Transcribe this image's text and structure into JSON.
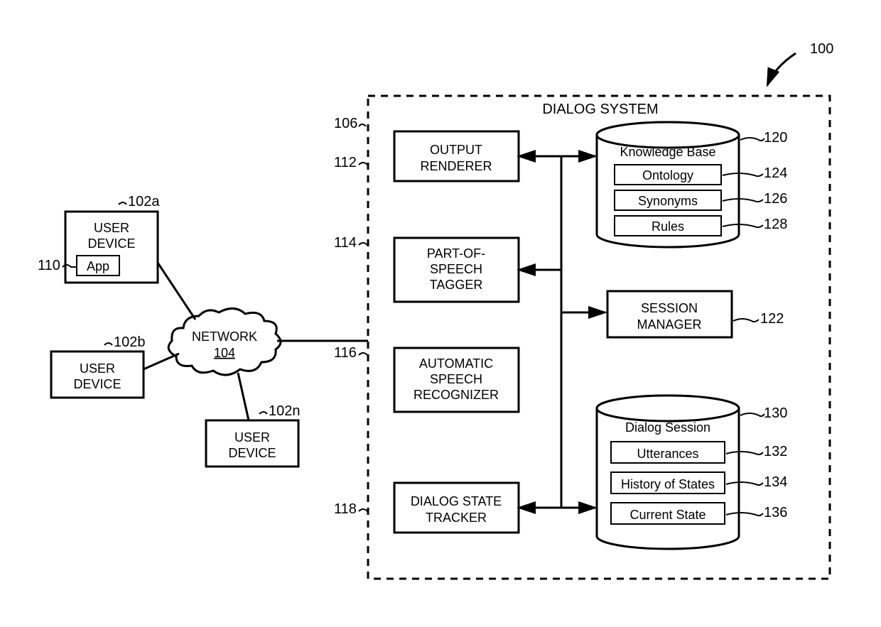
{
  "diagram": {
    "systemLabel": "100",
    "systemTitle": "DIALOG SYSTEM",
    "systemRef": "106",
    "userDevice1": {
      "label": "USER DEVICE",
      "ref": "102a",
      "app": "App",
      "appRef": "110"
    },
    "userDevice2": {
      "label": "USER DEVICE",
      "ref": "102b"
    },
    "userDevice3": {
      "label": "USER DEVICE",
      "ref": "102n"
    },
    "network": {
      "label": "NETWORK",
      "ref": "104"
    },
    "outputRenderer": {
      "label1": "OUTPUT",
      "label2": "RENDERER",
      "ref": "112"
    },
    "posTagger": {
      "label1": "PART-OF-",
      "label2": "SPEECH",
      "label3": "TAGGER",
      "ref": "114"
    },
    "asr": {
      "label1": "AUTOMATIC",
      "label2": "SPEECH",
      "label3": "RECOGNIZER",
      "ref": "116"
    },
    "dst": {
      "label1": "DIALOG STATE",
      "label2": "TRACKER",
      "ref": "118"
    },
    "sessionMgr": {
      "label1": "SESSION",
      "label2": "MANAGER",
      "ref": "122"
    },
    "knowledgeBase": {
      "title": "Knowledge Base",
      "ref": "120",
      "ontology": "Ontology",
      "ontologyRef": "124",
      "synonyms": "Synonyms",
      "synonymsRef": "126",
      "rules": "Rules",
      "rulesRef": "128"
    },
    "dialogSession": {
      "title": "Dialog Session",
      "ref": "130",
      "utterances": "Utterances",
      "utterancesRef": "132",
      "history": "History of States",
      "historyRef": "134",
      "current": "Current State",
      "currentRef": "136"
    }
  }
}
